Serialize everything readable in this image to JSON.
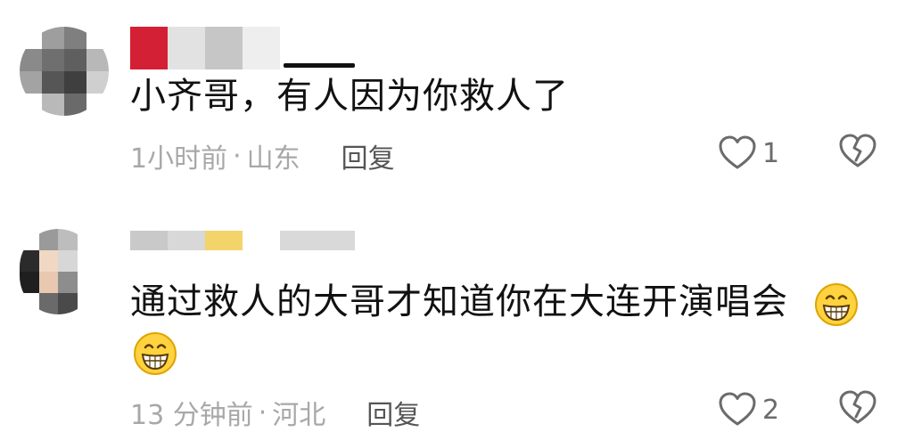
{
  "comments": [
    {
      "text": "小齐哥，有人因为你救人了",
      "time": "1小时前",
      "location": "山东",
      "separator": "·",
      "reply_label": "回复",
      "likes": "1",
      "name_mosaic_colors": [
        "#d42034",
        "#e2e2e2",
        "#c6c6c6",
        "#eeeeee"
      ],
      "avatar_tiles": [
        "#ffffff",
        "#9e9e9e",
        "#7f7f7f",
        "#ffffff",
        "#8a8a8a",
        "#6f6f6f",
        "#5f5f5f",
        "#b8b8b8",
        "#a3a3a3",
        "#565656",
        "#3f3f3f",
        "#cfcfcf",
        "#ffffff",
        "#b9b9b9",
        "#6a6a6a",
        "#ffffff"
      ]
    },
    {
      "text": "通过救人的大哥才知道你在大连开演唱会",
      "time": "13 分钟前",
      "location": "河北",
      "separator": "·",
      "reply_label": "回复",
      "likes": "2",
      "name_mosaic_colors": [
        "#c9c9c9",
        "#d8d8d8",
        "#f3d46b",
        "#ffffff",
        "#d9d9d9",
        "#d9d9d9"
      ],
      "avatar_tiles": [
        "#ffffff",
        "#9a9a9a",
        "#bdbdbd",
        "#ffffff",
        "#2b2b2b",
        "#f0d8c4",
        "#d7d7d7",
        "#ffffff",
        "#1f1f1f",
        "#e8c8b0",
        "#8d8d8d",
        "#ffffff",
        "#ffffff",
        "#6a6a6a",
        "#4a4a4a",
        "#ffffff"
      ]
    }
  ],
  "icons": {
    "like": "heart-outline-icon",
    "dislike": "broken-heart-icon",
    "emoji": "grinning-emoji-icon"
  },
  "colors": {
    "text_primary": "#111111",
    "text_meta": "#a8a8a8",
    "reply": "#555555",
    "icon_stroke": "#6b6b6b",
    "emoji_face": "#ffd23f"
  }
}
